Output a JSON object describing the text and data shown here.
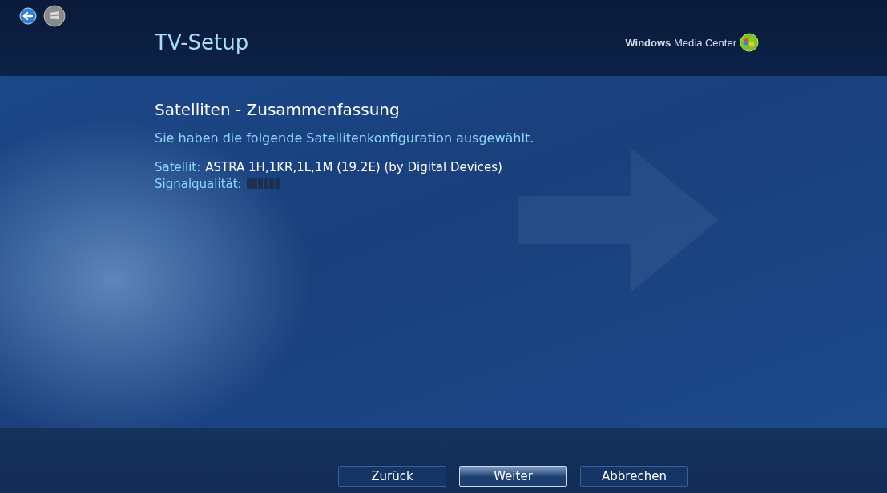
{
  "header": {
    "title": "TV-Setup",
    "brand": "**Windows** Media Center"
  },
  "page": {
    "heading": "Satelliten - Zusammenfassung",
    "intro": "Sie haben die folgende Satellitenkonfiguration ausgewählt.",
    "fields": [
      {
        "label": "Satellit:",
        "value": "ASTRA 1H,1KR,1L,1M (19.2E) (by Digital Devices)",
        "kind": "text"
      },
      {
        "label": "Signalqualität:",
        "kind": "meter",
        "level": 0
      }
    ]
  },
  "buttons": [
    {
      "label": "Zurück",
      "selected": false
    },
    {
      "label": "Weiter",
      "selected": true
    },
    {
      "label": "Abbrechen",
      "selected": false
    }
  ]
}
